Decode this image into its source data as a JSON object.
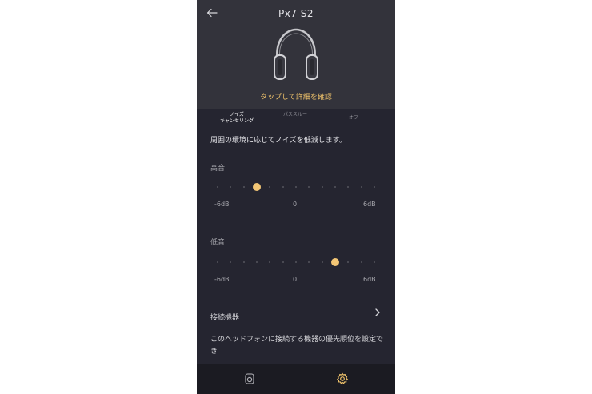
{
  "header": {
    "back_icon": "arrow-left-icon",
    "title": "Px7 S2",
    "tap_text": "タップして詳細を確認"
  },
  "tabs": [
    {
      "label": "ノイズ\nキャンセリング",
      "active": true
    },
    {
      "label": "パススルー",
      "active": false
    },
    {
      "label": "オフ",
      "active": false
    }
  ],
  "noise_desc": "周囲の環境に応じてノイズを低減します。",
  "eq": {
    "treble": {
      "label": "高音",
      "value_db": -3,
      "min_label": "-6dB",
      "mid_label": "0",
      "max_label": "6dB"
    },
    "bass": {
      "label": "低音",
      "value_db": 3,
      "min_label": "-6dB",
      "mid_label": "0",
      "max_label": "6dB"
    },
    "min_db": -6,
    "max_db": 6
  },
  "connection": {
    "label": "接続機器",
    "chevron_icon": "chevron-right-icon",
    "description": "このヘッドフォンに接続する機器の優先順位を設定でき"
  },
  "nav": {
    "left_icon": "headphone-device-icon",
    "right_icon": "gear-icon",
    "accent": "#f0c36b"
  }
}
